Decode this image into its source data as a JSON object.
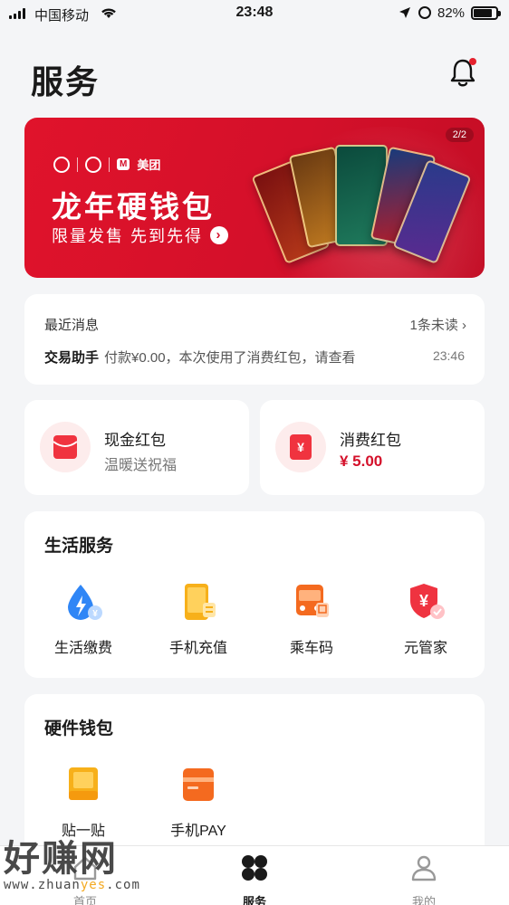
{
  "status_bar": {
    "carrier": "中国移动",
    "time": "23:48",
    "battery": "82%",
    "battery_level": 0.82
  },
  "header": {
    "title": "服务",
    "bell_icon": "bell-icon"
  },
  "banner": {
    "logo_text": "美团",
    "title": "龙年硬钱包",
    "subtitle": "限量发售 先到先得",
    "pager": "2/2",
    "colors": {
      "background": "#d4102a"
    }
  },
  "messages": {
    "heading": "最近消息",
    "unread": "1条未读",
    "sender": "交易助手",
    "content": "付款¥0.00，本次使用了消费红包，请查看",
    "time": "23:46"
  },
  "red_packets": [
    {
      "title": "现金红包",
      "subtitle": "温暖送祝福",
      "icon": "red-envelope-icon"
    },
    {
      "title": "消费红包",
      "amount": "¥ 5.00",
      "icon": "voucher-icon"
    }
  ],
  "life_services": {
    "title": "生活服务",
    "items": [
      {
        "label": "生活缴费",
        "icon": "utility-bill-icon"
      },
      {
        "label": "手机充值",
        "icon": "phone-topup-icon"
      },
      {
        "label": "乘车码",
        "icon": "bus-code-icon"
      },
      {
        "label": "元管家",
        "icon": "shield-yuan-icon"
      }
    ]
  },
  "hardware_wallet": {
    "title": "硬件钱包",
    "items": [
      {
        "label": "贴一贴",
        "icon": "tap-card-icon"
      },
      {
        "label": "手机PAY",
        "icon": "phone-pay-icon"
      }
    ]
  },
  "tabbar": {
    "tabs": [
      {
        "label": "首页",
        "icon": "home-icon"
      },
      {
        "label": "服务",
        "icon": "services-grid-icon",
        "active": true
      },
      {
        "label": "我的",
        "icon": "profile-icon"
      }
    ]
  },
  "watermark": {
    "brand": "好赚网",
    "url_prefix": "www.zhuan",
    "url_highlight": "yes",
    "url_suffix": ".com"
  }
}
